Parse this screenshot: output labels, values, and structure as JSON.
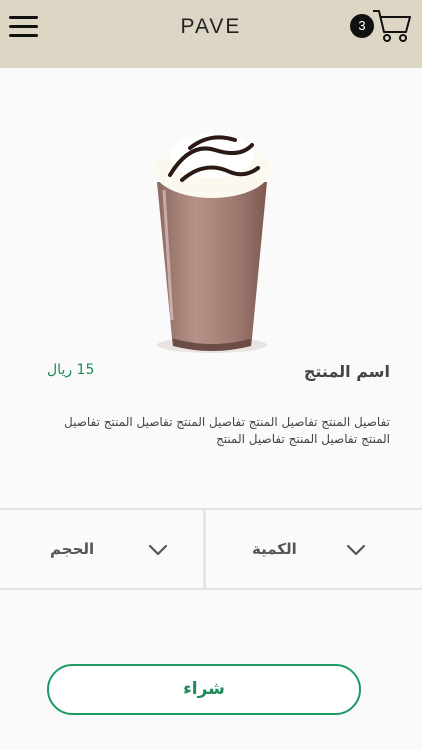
{
  "header": {
    "brand": "PAVE",
    "cart_count": "3",
    "menu_icon": "hamburger-menu-icon",
    "cart_icon": "shopping-cart-icon"
  },
  "product": {
    "name": "اسم المنتج",
    "price": "15 ريال",
    "description": "تفاصيل المنتج تفاصيل المنتج تفاصيل المنتج تفاصيل المنتج تفاصيل المنتج تفاصيل المنتج تفاصيل المنتج",
    "image_icon": "iced-chocolate-frappe-image"
  },
  "options": {
    "quantity_label": "الكمية",
    "size_label": "الحجم",
    "dropdown_icon": "chevron-down-icon"
  },
  "actions": {
    "buy_label": "شراء"
  },
  "colors": {
    "header_bg": "#ded6c5",
    "accent_green": "#1b8b57"
  }
}
